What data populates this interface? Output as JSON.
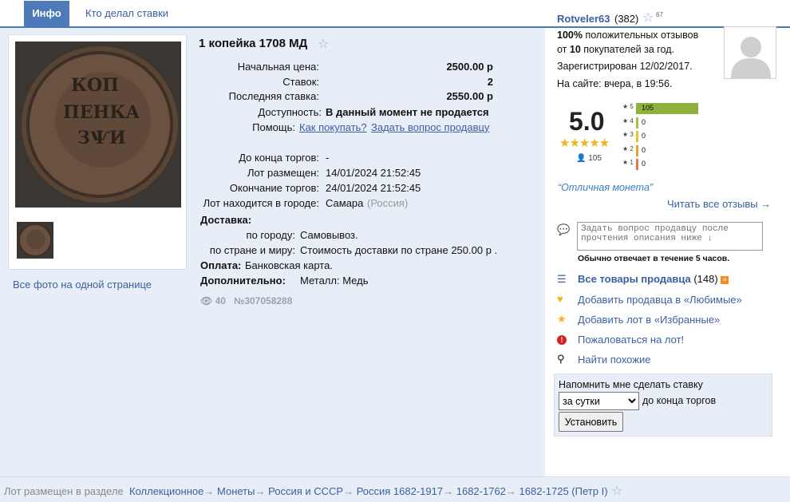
{
  "tabs": {
    "info": "Инфо",
    "bidders": "Кто делал ставки"
  },
  "lot": {
    "title": "1 копейка 1708 МД",
    "start_price_label": "Начальная цена:",
    "start_price": "2500.00 р",
    "bids_label": "Ставок:",
    "bids": "2",
    "last_bid_label": "Последняя ставка:",
    "last_bid": "2550.00 р",
    "availability_label": "Доступность:",
    "availability": "В данный момент не продается",
    "help_label": "Помощь:",
    "help_how": "Как покупать?",
    "help_ask": "Задать вопрос продавцу",
    "time_left_label": "До конца торгов:",
    "time_left": "-",
    "posted_label": "Лот размещен:",
    "posted": "14/01/2024 21:52:45",
    "ends_label": "Окончание торгов:",
    "ends": "24/01/2024 21:52:45",
    "city_label": "Лот находится в городе:",
    "city": "Самара",
    "country": "(Россия)",
    "delivery_label": "Доставка:",
    "city_delivery_label": "по городу:",
    "city_delivery": "Самовывоз.",
    "world_delivery_label": "по стране и миру:",
    "world_delivery": "Стоимость доставки по стране 250.00 р .",
    "payment_label": "Оплата:",
    "payment": "Банковская карта.",
    "extra_label": "Дополнительно:",
    "extra": "Металл: Медь",
    "views": "40",
    "lot_number": "№307058288",
    "all_photos": "Все фото на одной странице"
  },
  "seller": {
    "name": "Rotveler63",
    "count": "(382)",
    "star_count": "67",
    "positive_pct": "100%",
    "positive_text": " положительных отзывов",
    "from_text": "от ",
    "buyers": "10",
    "buyers_text": " покупателей за год.",
    "registered": "Зарегистрирован 12/02/2017.",
    "online": "На сайте: вчера, в 19:56.",
    "rating": "5.0",
    "rating_stars": "★★★★★",
    "reviews_total": "105",
    "rating_rows": [
      {
        "label": "★ 5",
        "count": "105",
        "share": 1.0,
        "color": "#8fb33a"
      },
      {
        "label": "★ 4",
        "count": "0",
        "share": 0,
        "color": "#a6c43a"
      },
      {
        "label": "★ 3",
        "count": "0",
        "share": 0,
        "color": "#e8c52a"
      },
      {
        "label": "★ 2",
        "count": "0",
        "share": 0,
        "color": "#e8a32a"
      },
      {
        "label": "★ 1",
        "count": "0",
        "share": 0,
        "color": "#e07a4a"
      }
    ],
    "quote": "“Отличная монета”",
    "read_all": "Читать все отзывы →",
    "question_placeholder": "Задать вопрос продавцу после прочтения описания ниже ↓",
    "response_note": "Обычно отвечает в течение 5 часов.",
    "all_items": "Все товары продавца",
    "all_items_count": "(148)",
    "add_favorite_seller": "Добавить продавца в «Любимые»",
    "add_favorite_lot": "Добавить лот в «Избранные»",
    "complain": "Пожаловаться на лот!",
    "find_similar": "Найти похожие"
  },
  "remind": {
    "title": "Напомнить мне сделать ставку",
    "selected": "за сутки",
    "after": "до конца торгов",
    "button": "Установить"
  },
  "footer": {
    "prefix": "Лот размещен в разделе",
    "crumbs": [
      "Коллекционное",
      "Монеты",
      "Россия и СССР",
      "Россия 1682-1917",
      "1682-1762",
      "1682-1725 (Петр I)"
    ]
  }
}
